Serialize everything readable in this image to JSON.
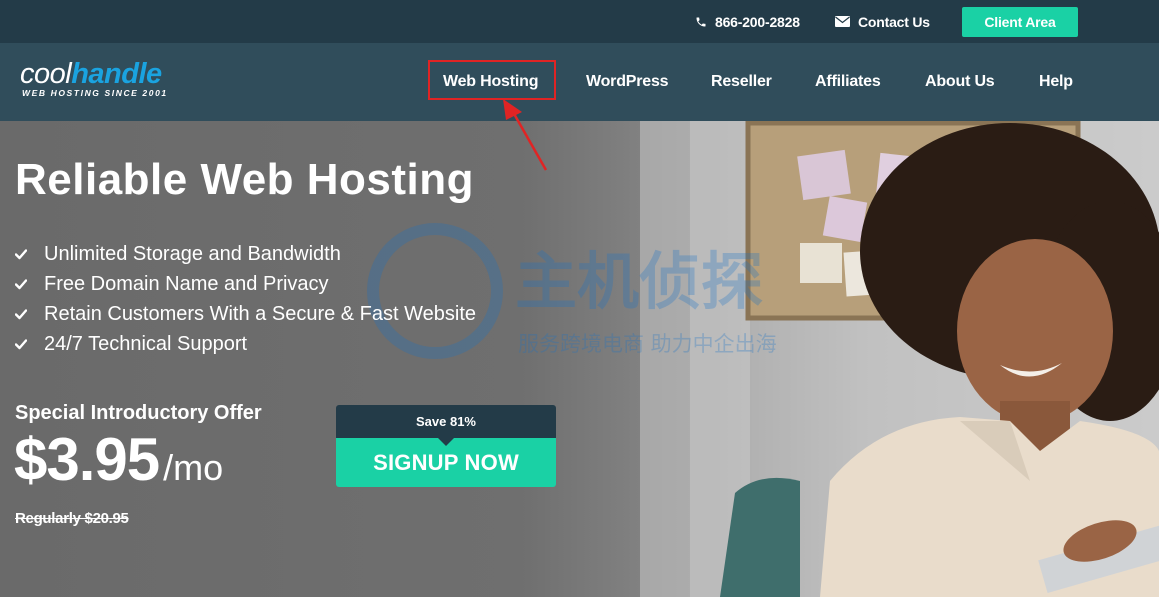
{
  "topbar": {
    "phone": "866-200-2828",
    "contact_label": "Contact Us",
    "client_area_label": "Client Area"
  },
  "logo": {
    "part1": "cool",
    "part2": "handle",
    "tagline": "WEB HOSTING SINCE 2001"
  },
  "nav": {
    "items": [
      {
        "label": "Web Hosting"
      },
      {
        "label": "WordPress"
      },
      {
        "label": "Reseller"
      },
      {
        "label": "Affiliates"
      },
      {
        "label": "About Us"
      },
      {
        "label": "Help"
      }
    ]
  },
  "hero": {
    "title": "Reliable Web Hosting",
    "features": [
      "Unlimited Storage and Bandwidth",
      "Free Domain Name and Privacy",
      "Retain Customers With a Secure & Fast Website",
      "24/7 Technical Support"
    ],
    "offer_label": "Special Introductory Offer",
    "price": "$3.95",
    "price_unit": "/mo",
    "regular_price": "Regularly $20.95",
    "save_label": "Save 81%",
    "signup_label": "SIGNUP NOW"
  },
  "colors": {
    "topbar_bg": "#233b48",
    "nav_bg": "#304d5b",
    "accent": "#1ad1a5",
    "logo_blue": "#1aa3e0",
    "annotation_red": "#e02424"
  }
}
